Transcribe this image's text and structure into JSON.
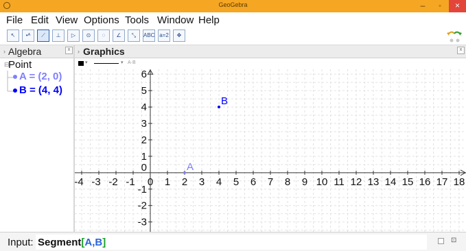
{
  "window": {
    "title": "GeoGebra",
    "minimize": "–",
    "maximize": "▫",
    "close": "×"
  },
  "menu": [
    "File",
    "Edit",
    "View",
    "Options",
    "Tools",
    "Window",
    "Help"
  ],
  "toolbar": {
    "tools": [
      {
        "icon": "move-tool-icon",
        "glyph": "↖"
      },
      {
        "icon": "point-tool-icon",
        "glyph": "•ᴬ"
      },
      {
        "icon": "line-tool-icon",
        "glyph": "⟋"
      },
      {
        "icon": "perpendicular-tool-icon",
        "glyph": "⊥"
      },
      {
        "icon": "polygon-tool-icon",
        "glyph": "▷"
      },
      {
        "icon": "circle-tool-icon",
        "glyph": "⊙"
      },
      {
        "icon": "conic-tool-icon",
        "glyph": "◌"
      },
      {
        "icon": "angle-tool-icon",
        "glyph": "∠"
      },
      {
        "icon": "reflect-tool-icon",
        "glyph": "⤡"
      },
      {
        "icon": "text-tool-icon",
        "glyph": "ABC"
      },
      {
        "icon": "slider-tool-icon",
        "glyph": "a=2"
      },
      {
        "icon": "move-view-tool-icon",
        "glyph": "✥"
      }
    ],
    "active_index": 2
  },
  "algebra": {
    "header": "Algebra",
    "group": "Point",
    "items": [
      {
        "text": "A = (2, 0)",
        "color": "#7f7fff"
      },
      {
        "text": "B = (4, 4)",
        "color": "#0000ff"
      }
    ]
  },
  "graphics": {
    "header": "Graphics",
    "x_ticks": [
      "-4",
      "-3",
      "-2",
      "-1",
      "0",
      "1",
      "2",
      "3",
      "4",
      "5",
      "6",
      "7",
      "8",
      "9",
      "10",
      "11",
      "12",
      "13",
      "14",
      "15",
      "16",
      "17",
      "18"
    ],
    "y_ticks": [
      "-3",
      "-2",
      "-1",
      "1",
      "2",
      "3",
      "4",
      "5",
      "6"
    ],
    "y_zero_label": "0",
    "xlim": [
      -4.4,
      18.4
    ],
    "ylim": [
      -3.6,
      6.3
    ],
    "points": [
      {
        "label": "A",
        "x": 2,
        "y": 0,
        "color": "#7f7fff"
      },
      {
        "label": "B",
        "x": 4,
        "y": 4,
        "color": "#0000ff"
      }
    ],
    "grid": true
  },
  "input": {
    "label": "Input:",
    "command": "Segment",
    "open_bracket": "[",
    "args": "A,B",
    "close_bracket": "]",
    "bracket_color": "#1aa02c",
    "args_color": "#2b63d9"
  }
}
